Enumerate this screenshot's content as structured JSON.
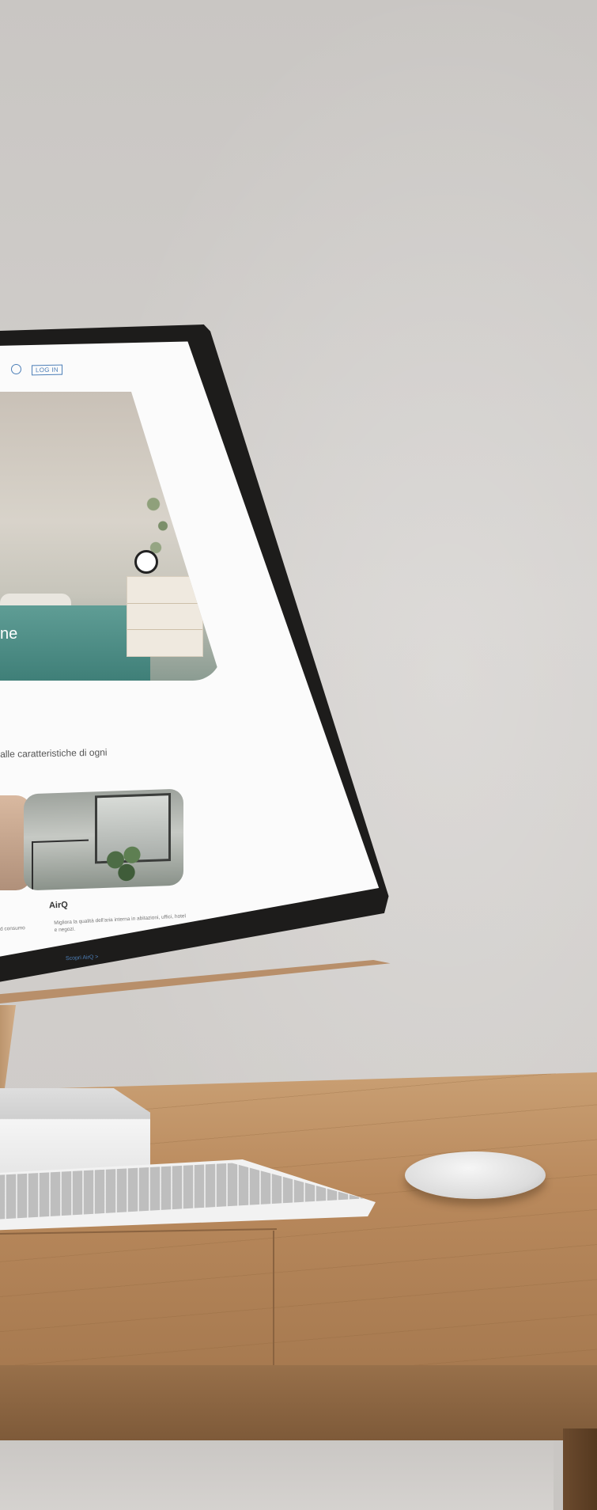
{
  "nav": {
    "login_label": "LOG IN"
  },
  "hero": {
    "text": "ne"
  },
  "section": {
    "text": "alle caratteristiche di ogni"
  },
  "cards": {
    "left_desc": "d consumo",
    "airq": {
      "title": "AirQ",
      "description": "Migliora la qualità dell'aria interna in abitazioni, uffici, hotel e negozi.",
      "link": "Scopri AirQ >"
    }
  }
}
